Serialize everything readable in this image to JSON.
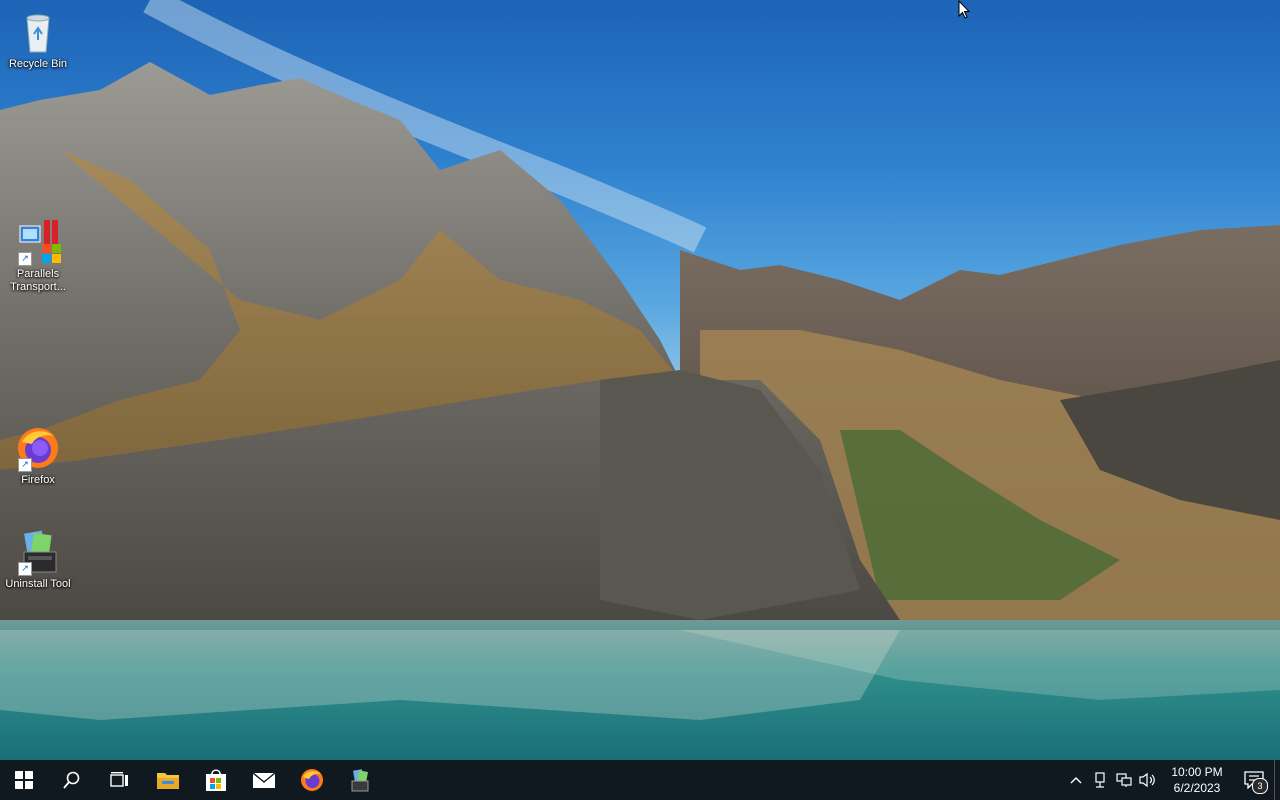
{
  "desktop": {
    "icons": [
      {
        "label": "Recycle Bin"
      },
      {
        "label": "Parallels Transport..."
      },
      {
        "label": "Firefox"
      },
      {
        "label": "Uninstall Tool"
      }
    ]
  },
  "taskbar": {
    "buttons": [
      {
        "name": "start-icon"
      },
      {
        "name": "search-icon"
      },
      {
        "name": "task-view-icon"
      },
      {
        "name": "file-explorer-icon"
      },
      {
        "name": "microsoft-store-icon"
      },
      {
        "name": "mail-icon"
      },
      {
        "name": "firefox-icon"
      },
      {
        "name": "uninstall-tool-icon"
      }
    ],
    "tray": {
      "time": "10:00 PM",
      "date": "6/2/2023",
      "notification_count": "3"
    }
  },
  "colors": {
    "taskbar": "#101820",
    "sky_top": "#1d63b6",
    "water": "#2f8f8c"
  }
}
